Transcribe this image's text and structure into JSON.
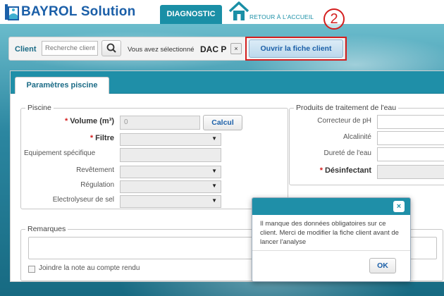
{
  "header": {
    "app_title": "BAYROL Solution",
    "tab_diagnostic": "DIAGNOSTIC",
    "home_link": "RETOUR À L'ACCUEIL",
    "step_number": "2"
  },
  "client_bar": {
    "label": "Client",
    "search_placeholder": "Recherche client",
    "selected_prefix": "Vous avez sélectionné",
    "selected_name": "DAC P",
    "clear_label": "×",
    "open_button": "Ouvrir la fiche client"
  },
  "panel": {
    "tab_label": "Paramètres piscine",
    "piscine": {
      "legend": "Piscine",
      "volume_label": "Volume (m³)",
      "volume_value": "0",
      "calc_button": "Calcul",
      "filtre_label": "Filtre",
      "equipement_label": "Equipement spécifique",
      "revetement_label": "Revêtement",
      "regulation_label": "Régulation",
      "electrolyseur_label": "Electrolyseur de sel"
    },
    "produits": {
      "legend": "Produits de traitement de l'eau",
      "correcteur_label": "Correcteur de pH",
      "alcalinite_label": "Alcalinité",
      "durete_label": "Dureté de l'eau",
      "desinfectant_label": "Désinfectant"
    },
    "remarques": {
      "legend": "Remarques",
      "join_note_label": "Joindre la note au compte rendu"
    }
  },
  "modal": {
    "message": "Il manque des données obligatoires sur ce client. Merci de modifier la fiche client avant de lancer l'analyse",
    "ok_button": "OK",
    "close_label": "×"
  },
  "colors": {
    "brand_blue": "#1b5fa8",
    "teal_header": "#1f8fa8",
    "highlight_red": "#d41e1e"
  }
}
